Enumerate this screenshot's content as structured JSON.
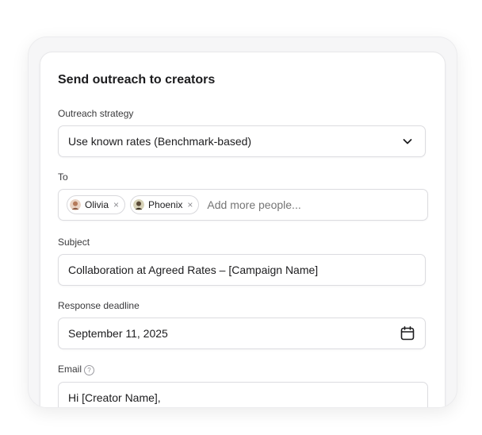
{
  "form": {
    "title": "Send outreach to creators",
    "strategy": {
      "label": "Outreach strategy",
      "value": "Use known rates (Benchmark-based)",
      "icon": "chevron-down-icon"
    },
    "to": {
      "label": "To",
      "recipients": [
        {
          "name": "Olivia",
          "remove": "×"
        },
        {
          "name": "Phoenix",
          "remove": "×"
        }
      ],
      "placeholder": "Add more people..."
    },
    "subject": {
      "label": "Subject",
      "value": "Collaboration at Agreed Rates – [Campaign Name]"
    },
    "deadline": {
      "label": "Response deadline",
      "value": "September 11, 2025",
      "icon": "calendar-icon"
    },
    "email": {
      "label": "Email",
      "help_glyph": "?",
      "body_first_line": "Hi [Creator Name],"
    }
  }
}
